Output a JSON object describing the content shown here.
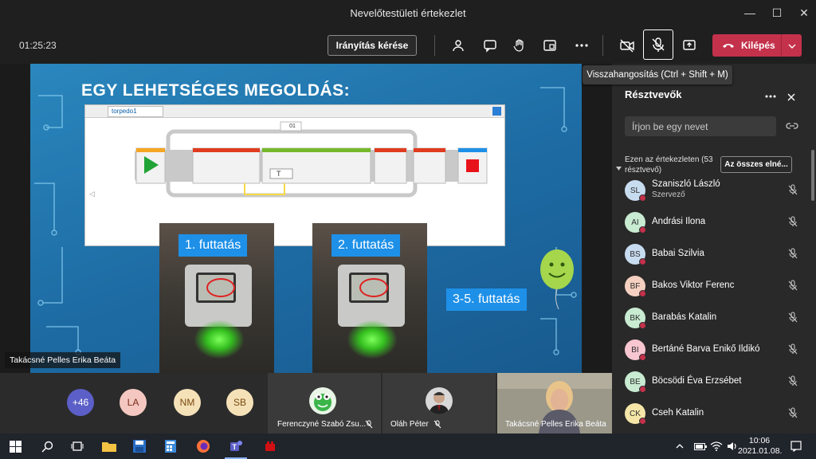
{
  "window": {
    "title": "Nevelőtestületi értekezlet"
  },
  "toolbar": {
    "timer": "01:25:23",
    "request_control_label": "Irányítás kérése",
    "leave_label": "Kilépés",
    "tooltip": "Visszahangosítás (Ctrl + Shift + M)"
  },
  "slide": {
    "title": "EGY LEHETSÉGES MEGOLDÁS:",
    "software_tab": "torpedo1",
    "loop_counter": "01",
    "run_labels": [
      "1. futtatás",
      "2. futtatás",
      "3-5. futtatás"
    ]
  },
  "stage": {
    "presenter_name": "Takácsné Pelles Erika Beáta"
  },
  "gallery": {
    "overflow_count": "+46",
    "avatars": [
      {
        "initials": "LA",
        "color": "#f4c8c0"
      },
      {
        "initials": "NM",
        "color": "#f5e1b8"
      },
      {
        "initials": "SB",
        "color": "#f5e1b8"
      }
    ],
    "tiles": [
      {
        "name": "Ferenczyné Szabó Zsu..."
      },
      {
        "name": "Oláh Péter"
      },
      {
        "name": "Takácsné Pelles Erika Beáta"
      }
    ]
  },
  "panel": {
    "title": "Résztvevők",
    "search_placeholder": "Írjon be egy nevet",
    "meeting_header": "Ezen az értekezleten (53 résztvevő)",
    "mute_all_label": "Az összes elné...",
    "participants": [
      {
        "initials": "SL",
        "name": "Szaniszló László",
        "role": "Szervező",
        "color": "#c8dcf0"
      },
      {
        "initials": "AI",
        "name": "Andrási Ilona",
        "role": "",
        "color": "#c8ebd2"
      },
      {
        "initials": "BS",
        "name": "Babai Szilvia",
        "role": "",
        "color": "#c8dcf0"
      },
      {
        "initials": "BF",
        "name": "Bakos Viktor Ferenc",
        "role": "",
        "color": "#f5d0c0"
      },
      {
        "initials": "BK",
        "name": "Barabás Katalin",
        "role": "",
        "color": "#c8ebd2"
      },
      {
        "initials": "BI",
        "name": "Bertáné Barva Enikő Ildikó",
        "role": "",
        "color": "#f7c6d0"
      },
      {
        "initials": "BE",
        "name": "Böcsödi Éva Erzsébet",
        "role": "",
        "color": "#c8ebd2"
      },
      {
        "initials": "CK",
        "name": "Cseh Katalin",
        "role": "",
        "color": "#f5e6a8"
      }
    ]
  },
  "taskbar": {
    "time": "10:06",
    "date": "2021.01.08."
  },
  "colors": {
    "leave": "#c4314b",
    "accent": "#1e90e8",
    "slide_bg": "#2a87bd"
  }
}
